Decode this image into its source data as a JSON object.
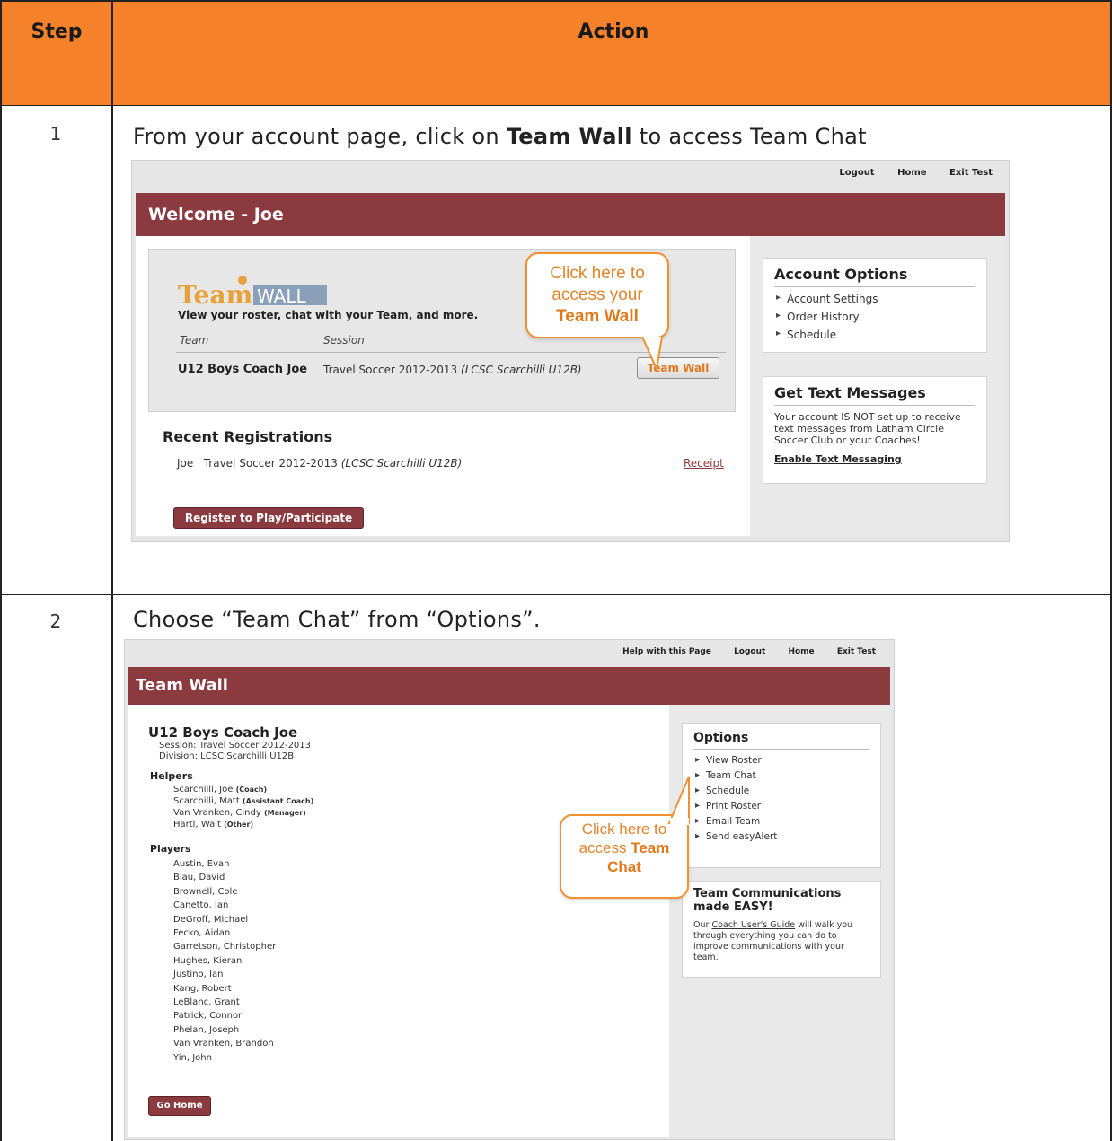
{
  "table": {
    "header_step": "Step",
    "header_action": "Action"
  },
  "step1": {
    "number": "1",
    "text_before": "From your account page, click on ",
    "text_bold": "Team Wall",
    "text_after": " to access Team Chat",
    "screen": {
      "nav": [
        "Logout",
        "Home",
        "Exit Test"
      ],
      "banner_title": "Welcome - Joe",
      "logo_text": "TeamWALL",
      "tagline": "View your roster, chat with your Team, and more.",
      "col_team": "Team",
      "col_session": "Session",
      "team_name": "U12 Boys Coach Joe",
      "session": "Travel Soccer 2012-2013",
      "session_detail": "(LCSC Scarchilli U12B)",
      "team_wall_button": "Team Wall",
      "callout_line1": "Click here to",
      "callout_line2": "access your",
      "callout_bold": "Team Wall",
      "recent_title": "Recent Registrations",
      "reg_name": "Joe",
      "reg_session": "Travel Soccer 2012-2013",
      "reg_detail": "(LCSC Scarchilli U12B)",
      "receipt_link": "Receipt",
      "register_button": "Register to Play/Participate",
      "account_options_title": "Account Options",
      "account_options": [
        "Account Settings",
        "Order History",
        "Schedule"
      ],
      "text_messages_title": "Get Text Messages",
      "text_messages_body": "Your account IS NOT set up to receive text messages from Latham Circle Soccer Club or your Coaches!",
      "enable_link": "Enable Text Messaging"
    }
  },
  "step2": {
    "number": "2",
    "text": "Choose “Team Chat” from “Options”.",
    "screen": {
      "nav": [
        "Help with this Page",
        "Logout",
        "Home",
        "Exit Test"
      ],
      "banner_title": "Team Wall",
      "team_name": "U12 Boys Coach Joe",
      "session_line": "Session: Travel Soccer 2012-2013",
      "division_line": "Division: LCSC Scarchilli U12B",
      "helpers_title": "Helpers",
      "helpers": [
        {
          "name": "Scarchilli, Joe",
          "role": "(Coach)"
        },
        {
          "name": "Scarchilli, Matt",
          "role": "(Assistant Coach)"
        },
        {
          "name": "Van Vranken, Cindy",
          "role": "(Manager)"
        },
        {
          "name": "Hartl, Walt",
          "role": "(Other)"
        }
      ],
      "players_title": "Players",
      "players": [
        "Austin, Evan",
        "Blau, David",
        "Brownell, Cole",
        "Canetto, Ian",
        "DeGroff, Michael",
        "Fecko, Aidan",
        "Garretson, Christopher",
        "Hughes, Kieran",
        "Justino, Ian",
        "Kang, Robert",
        "LeBlanc, Grant",
        "Patrick, Connor",
        "Phelan, Joseph",
        "Van Vranken, Brandon",
        "Yin, John"
      ],
      "go_home_button": "Go Home",
      "options_title": "Options",
      "options": [
        "View Roster",
        "Team Chat",
        "Schedule",
        "Print Roster",
        "Email Team",
        "Send easyAlert"
      ],
      "callout_line1": "Click here to",
      "callout_line2": "access ",
      "callout_bold1": "Team",
      "callout_bold2": "Chat",
      "comm_title_line1": "Team Communications",
      "comm_title_line2": "made EASY!",
      "comm_body_before": "Our ",
      "comm_link": "Coach User's Guide",
      "comm_body_after": " will walk you through everything you can do to improve communications with your team."
    }
  },
  "colors": {
    "header_orange": "#f5822a",
    "banner_maroon": "#8b3a3f",
    "callout_orange": "#f0902f"
  }
}
